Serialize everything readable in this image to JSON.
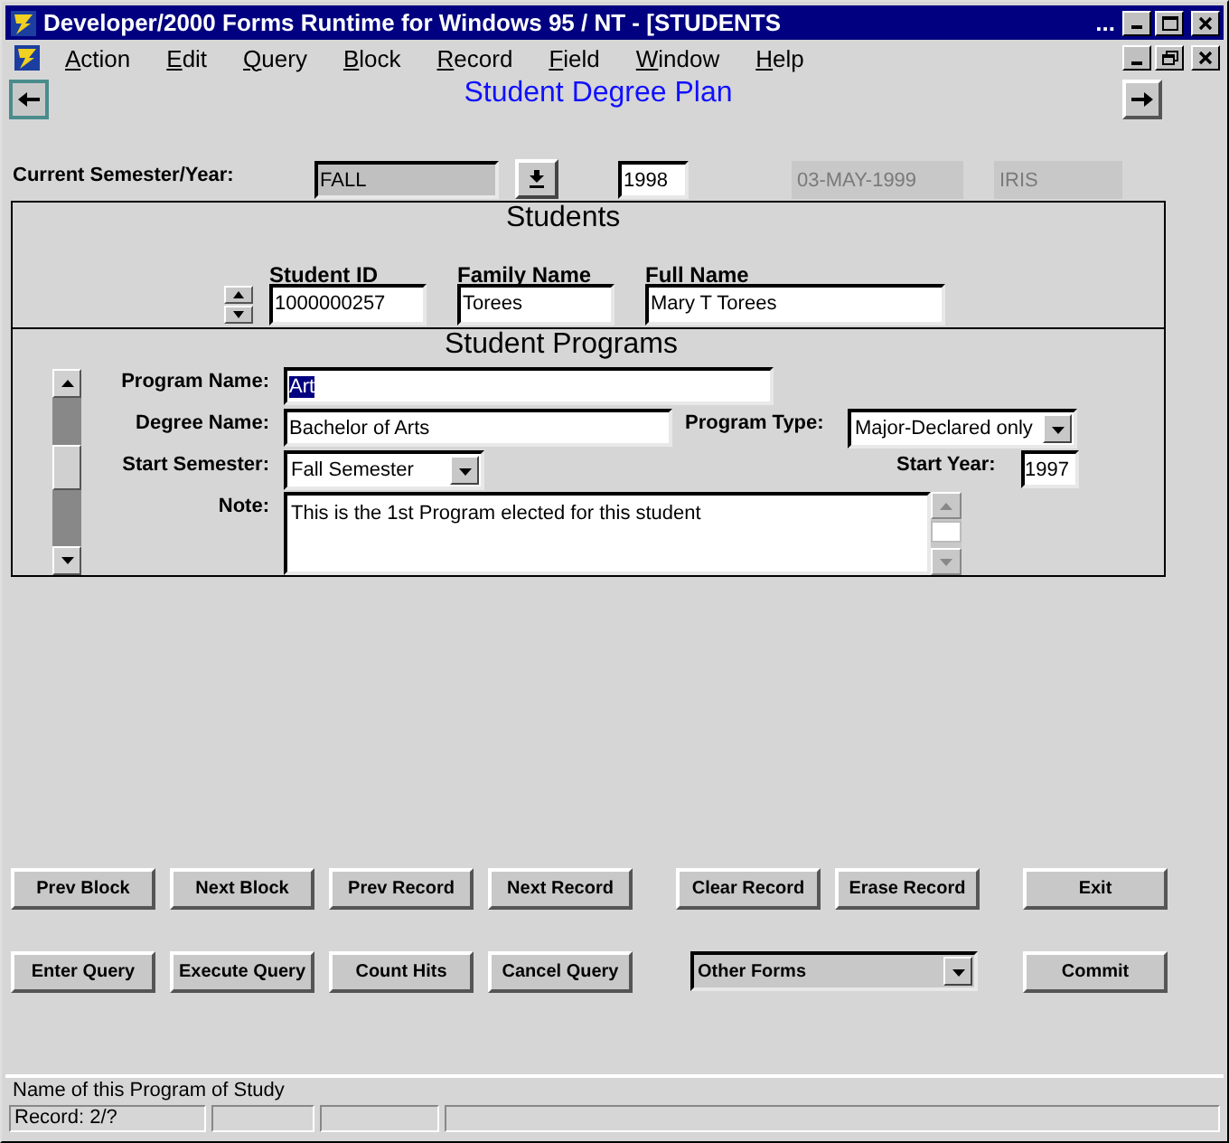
{
  "window": {
    "title": "Developer/2000 Forms Runtime for Windows 95 / NT - [STUDENTS",
    "title_ellipsis": "..."
  },
  "menu": [
    {
      "label": "Action"
    },
    {
      "label": "Edit"
    },
    {
      "label": "Query"
    },
    {
      "label": "Block"
    },
    {
      "label": "Record"
    },
    {
      "label": "Field"
    },
    {
      "label": "Window"
    },
    {
      "label": "Help"
    }
  ],
  "form": {
    "heading": "Student Degree Plan"
  },
  "context": {
    "label": "Current Semester/Year:",
    "semester": "FALL",
    "year": "1998",
    "date": {
      "value": "03-MAY-1999",
      "disabled": true
    },
    "user": {
      "value": "IRIS",
      "disabled": true
    }
  },
  "students": {
    "title": "Students",
    "fields": [
      {
        "label": "Student ID",
        "value": "1000000257"
      },
      {
        "label": "Family Name",
        "value": "Torees"
      },
      {
        "label": "Full Name",
        "value": "Mary T Torees"
      }
    ]
  },
  "programs": {
    "title": "Student Programs",
    "program_name": {
      "label": "Program Name:",
      "value": "Art",
      "text_selected": true
    },
    "degree_name": {
      "label": "Degree Name:",
      "value": "Bachelor of Arts"
    },
    "program_type": {
      "label": "Program Type:",
      "value": "Major-Declared only"
    },
    "start_semester": {
      "label": "Start Semester:",
      "value": "Fall Semester"
    },
    "start_year": {
      "label": "Start Year:",
      "value": "1997"
    },
    "note": {
      "label": "Note:",
      "value": "This is the 1st Program elected for this student"
    }
  },
  "button_rows": [
    [
      {
        "kind": "button",
        "label": "Prev Block"
      },
      {
        "kind": "button",
        "label": "Next Block"
      },
      {
        "kind": "button",
        "label": "Prev Record"
      },
      {
        "kind": "button",
        "label": "Next Record"
      },
      {
        "kind": "button",
        "label": "Clear Record"
      },
      {
        "kind": "button",
        "label": "Erase Record"
      },
      {
        "kind": "button",
        "label": "Exit"
      }
    ],
    [
      {
        "kind": "button",
        "label": "Enter Query"
      },
      {
        "kind": "button",
        "label": "Execute Query"
      },
      {
        "kind": "button",
        "label": "Count Hits"
      },
      {
        "kind": "button",
        "label": "Cancel Query"
      },
      {
        "kind": "dropdown",
        "label": "Other Forms"
      },
      {
        "kind": "button",
        "label": "Commit"
      }
    ]
  ],
  "status_bar": {
    "message": "Name of this Program of Study",
    "record": "Record: 2/?"
  }
}
